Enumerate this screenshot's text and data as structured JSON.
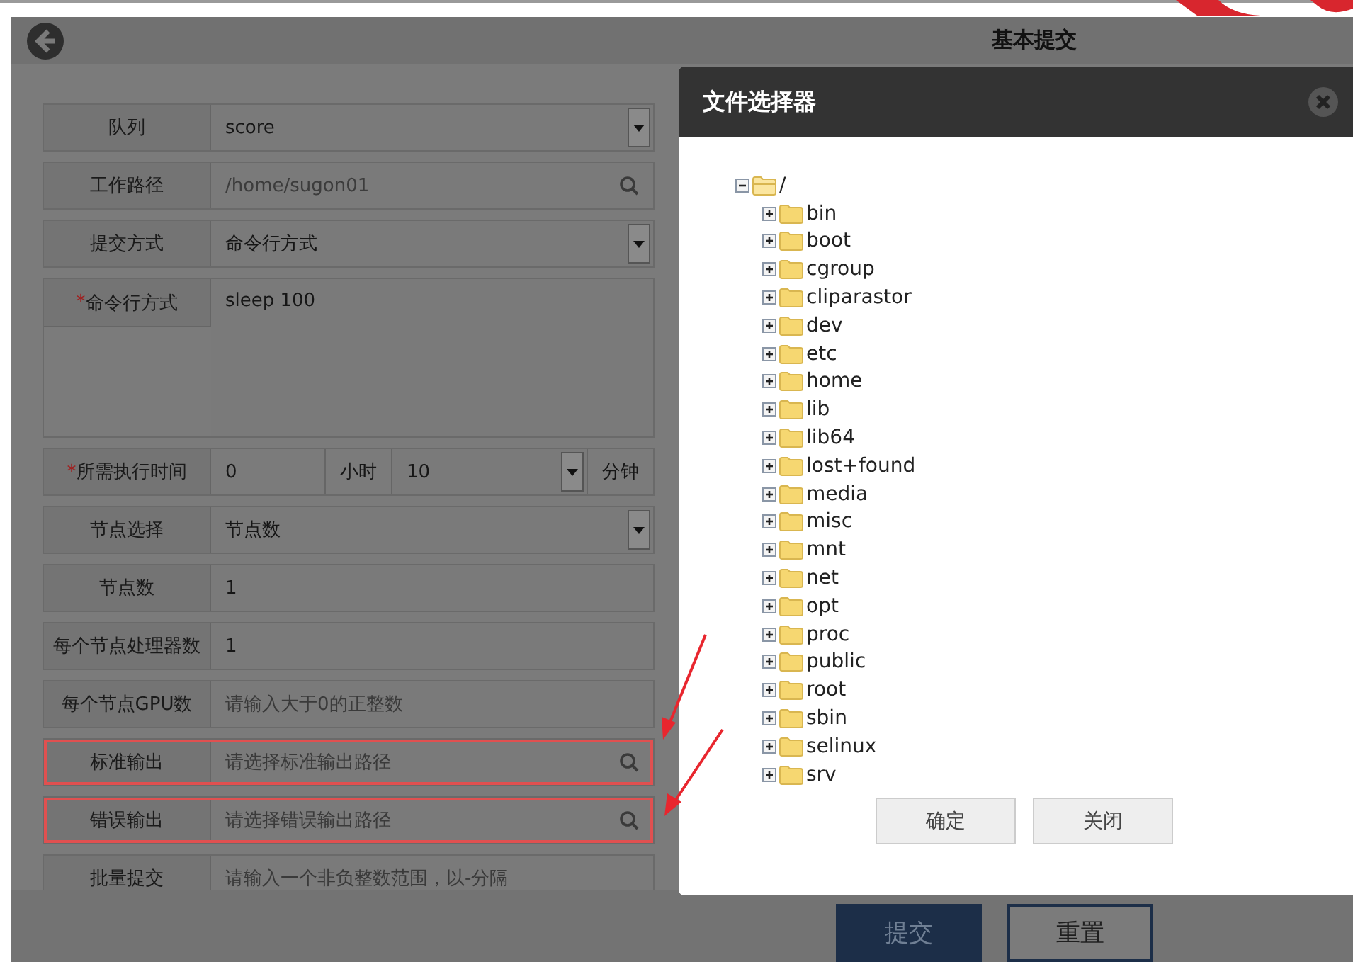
{
  "header": {
    "title": "基本提交"
  },
  "form": {
    "rows": [
      {
        "kind": "select",
        "label": "队列",
        "value": "score",
        "highlighted": false
      },
      {
        "kind": "search",
        "label": "工作路径",
        "value": "/home/sugon01",
        "highlighted": false
      },
      {
        "kind": "select",
        "label": "提交方式",
        "value": "命令行方式",
        "highlighted": false
      },
      {
        "kind": "textarea",
        "label": "命令行方式",
        "required_mark": "*",
        "value": "sleep 100",
        "highlighted": false
      },
      {
        "kind": "time",
        "label": "所需执行时间",
        "required_mark": "*",
        "hours": "0",
        "hours_unit": "小时",
        "minutes": "10",
        "minutes_unit": "分钟",
        "highlighted": false
      },
      {
        "kind": "select",
        "label": "节点选择",
        "value": "节点数",
        "highlighted": false
      },
      {
        "kind": "text",
        "label": "节点数",
        "value": "1",
        "highlighted": false
      },
      {
        "kind": "text",
        "label": "每个节点处理器数",
        "value": "1",
        "highlighted": false
      },
      {
        "kind": "text",
        "label": "每个节点GPU数",
        "placeholder": "请输入大于0的正整数",
        "highlighted": false
      },
      {
        "kind": "search",
        "label": "标准输出",
        "placeholder": "请选择标准输出路径",
        "highlighted": true
      },
      {
        "kind": "search",
        "label": "错误输出",
        "placeholder": "请选择错误输出路径",
        "highlighted": true
      },
      {
        "kind": "text",
        "label": "批量提交",
        "placeholder": "请输入一个非负整数范围，以-分隔",
        "highlighted": false
      }
    ]
  },
  "footer_buttons": [
    {
      "label": "提交",
      "kind": "primary"
    },
    {
      "label": "重置",
      "kind": "secondary"
    }
  ],
  "dialog": {
    "title": "文件选择器",
    "tree": [
      {
        "name": "/",
        "expanded": true,
        "children": [
          {
            "name": "bin",
            "expanded": false
          },
          {
            "name": "boot",
            "expanded": false
          },
          {
            "name": "cgroup",
            "expanded": false
          },
          {
            "name": "cliparastor",
            "expanded": false
          },
          {
            "name": "dev",
            "expanded": false
          },
          {
            "name": "etc",
            "expanded": false
          },
          {
            "name": "home",
            "expanded": false
          },
          {
            "name": "lib",
            "expanded": false
          },
          {
            "name": "lib64",
            "expanded": false
          },
          {
            "name": "lost+found",
            "expanded": false
          },
          {
            "name": "media",
            "expanded": false
          },
          {
            "name": "misc",
            "expanded": false
          },
          {
            "name": "mnt",
            "expanded": false
          },
          {
            "name": "net",
            "expanded": false
          },
          {
            "name": "opt",
            "expanded": false
          },
          {
            "name": "proc",
            "expanded": false
          },
          {
            "name": "public",
            "expanded": false
          },
          {
            "name": "root",
            "expanded": false
          },
          {
            "name": "sbin",
            "expanded": false
          },
          {
            "name": "selinux",
            "expanded": false
          },
          {
            "name": "srv",
            "expanded": false
          }
        ]
      }
    ],
    "buttons": [
      "确定",
      "关闭"
    ]
  }
}
